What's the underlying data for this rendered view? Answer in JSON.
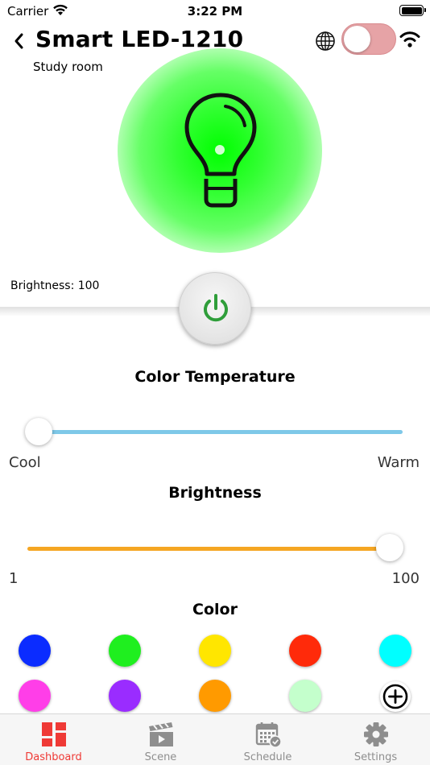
{
  "status_bar": {
    "carrier": "Carrier",
    "time": "3:22 PM"
  },
  "header": {
    "title": "Smart LED-1210",
    "room": "Study room",
    "power_on": false
  },
  "bulb": {
    "glow_color": "#00ff00"
  },
  "brightness_readout": "Brightness: 100",
  "color_temperature": {
    "heading": "Color Temperature",
    "min_label": "Cool",
    "max_label": "Warm",
    "value_fraction": 0.0,
    "track_color": "#7ec8e8"
  },
  "brightness": {
    "heading": "Brightness",
    "min_label": "1",
    "max_label": "100",
    "min": 1,
    "max": 100,
    "value": 100,
    "track_color": "#f5a623"
  },
  "color": {
    "heading": "Color",
    "swatches": [
      "#0b2cff",
      "#1fef1f",
      "#ffe600",
      "#ff2a0a",
      "#00ffff",
      "#ff3ee8",
      "#9a2cff",
      "#ff9a00",
      "#c4ffcc"
    ]
  },
  "tabs": [
    {
      "label": "Dashboard",
      "icon": "dashboard-icon",
      "active": true
    },
    {
      "label": "Scene",
      "icon": "clapperboard-icon",
      "active": false
    },
    {
      "label": "Schedule",
      "icon": "calendar-icon",
      "active": false
    },
    {
      "label": "Settings",
      "icon": "gear-icon",
      "active": false
    }
  ],
  "accent_color": "#ef3a36"
}
